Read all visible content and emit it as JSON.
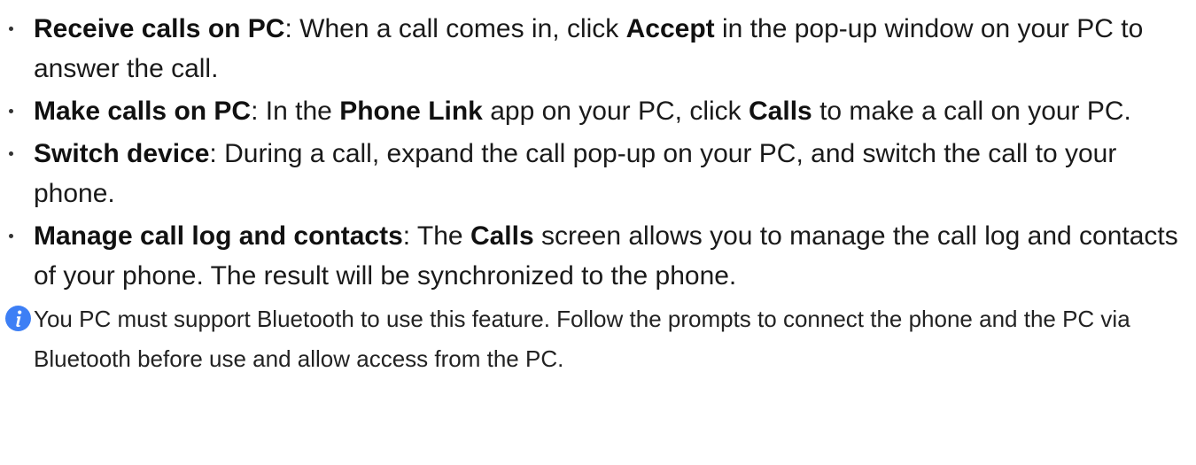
{
  "items": [
    {
      "icon": "bullet-dot",
      "parts": [
        {
          "bold": true,
          "text": "Receive calls on PC"
        },
        {
          "bold": false,
          "text": ": When a call comes in, click "
        },
        {
          "bold": true,
          "text": "Accept"
        },
        {
          "bold": false,
          "text": " in the pop-up window on your PC to answer the call."
        }
      ]
    },
    {
      "icon": "bullet-dot",
      "parts": [
        {
          "bold": true,
          "text": "Make calls on PC"
        },
        {
          "bold": false,
          "text": ": In the "
        },
        {
          "bold": true,
          "text": "Phone Link"
        },
        {
          "bold": false,
          "text": " app on your PC, click "
        },
        {
          "bold": true,
          "text": "Calls"
        },
        {
          "bold": false,
          "text": " to make a call on your PC."
        }
      ]
    },
    {
      "icon": "bullet-dot",
      "parts": [
        {
          "bold": true,
          "text": "Switch device"
        },
        {
          "bold": false,
          "text": ": During a call, expand the call pop-up on your PC, and switch the call to your phone."
        }
      ]
    },
    {
      "icon": "bullet-dot",
      "parts": [
        {
          "bold": true,
          "text": "Manage call log and contacts"
        },
        {
          "bold": false,
          "text": ": The "
        },
        {
          "bold": true,
          "text": "Calls"
        },
        {
          "bold": false,
          "text": " screen allows you to manage the call log and contacts of your phone. The result will be synchronized to the phone."
        }
      ]
    }
  ],
  "note": {
    "icon": "info-icon",
    "icon_color": "#3d7ff5",
    "text": "You PC must support Bluetooth to use this feature. Follow the prompts to connect the phone and the PC via Bluetooth before use and allow access from the PC."
  }
}
